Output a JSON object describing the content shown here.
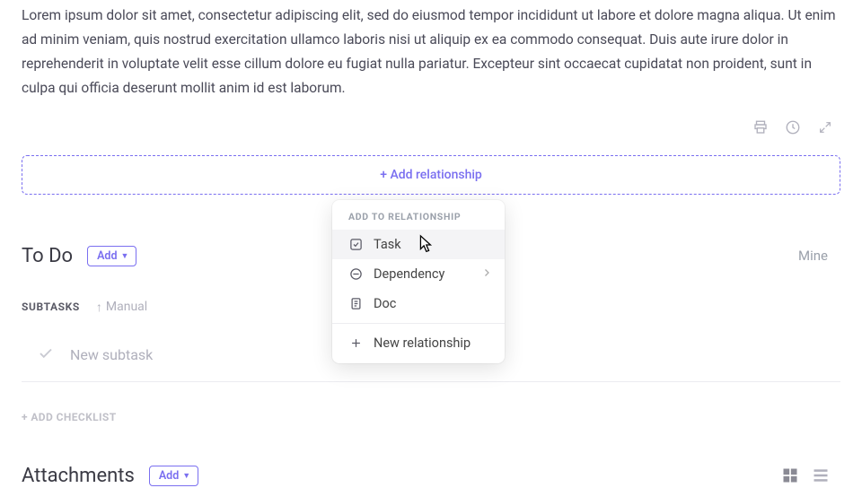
{
  "description": "Lorem ipsum dolor sit amet, consectetur adipiscing elit, sed do eiusmod tempor incididunt ut labore et dolore magna aliqua. Ut enim ad minim veniam, quis nostrud exercitation ullamco laboris nisi ut aliquip ex ea commodo consequat. Duis aute irure dolor in reprehenderit in voluptate velit esse cillum dolore eu fugiat nulla pariatur. Excepteur sint occaecat cupidatat non proident, sunt in culpa qui officia deserunt mollit anim id est laborum.",
  "add_relationship_label": "+ Add relationship",
  "dropdown": {
    "header": "ADD TO RELATIONSHIP",
    "items": [
      {
        "label": "Task"
      },
      {
        "label": "Dependency"
      },
      {
        "label": "Doc"
      },
      {
        "label": "New relationship"
      }
    ]
  },
  "todo": {
    "title": "To Do",
    "add_label": "Add",
    "mine_label": "Mine"
  },
  "subtasks": {
    "header": "SUBTASKS",
    "manual": "Manual",
    "placeholder": "New subtask"
  },
  "add_checklist": "+ ADD CHECKLIST",
  "attachments": {
    "title": "Attachments",
    "add_label": "Add"
  }
}
